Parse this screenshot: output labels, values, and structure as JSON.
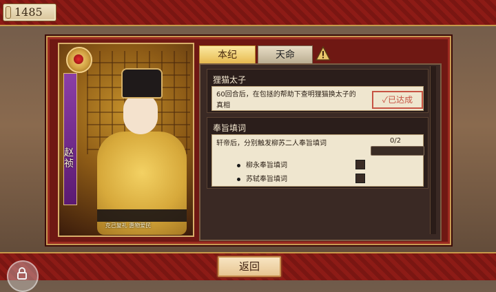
{
  "top": {
    "currency_value": "1485"
  },
  "portrait": {
    "name_vertical": "赵祯",
    "caption": "克己复礼 惠物爱民"
  },
  "tabs": {
    "active": "本纪",
    "inactive": "天命"
  },
  "quests": [
    {
      "title": "狸猫太子",
      "description": "60回合后，在包拯的帮助下查明狸猫换太子的真相",
      "stamp": "✓已达成"
    },
    {
      "title": "奉旨填词",
      "requirement": "轩帝后，分别触发柳苏二人奉旨填词",
      "progress_text": "0/2",
      "progress": 0.0,
      "subtasks": [
        {
          "label": "柳永奉旨填词"
        },
        {
          "label": "苏轼奉旨填词"
        }
      ]
    }
  ],
  "bottom": {
    "back_label": "返回"
  },
  "icons": {
    "warning": "warning-icon",
    "lock": "lock-icon"
  }
}
